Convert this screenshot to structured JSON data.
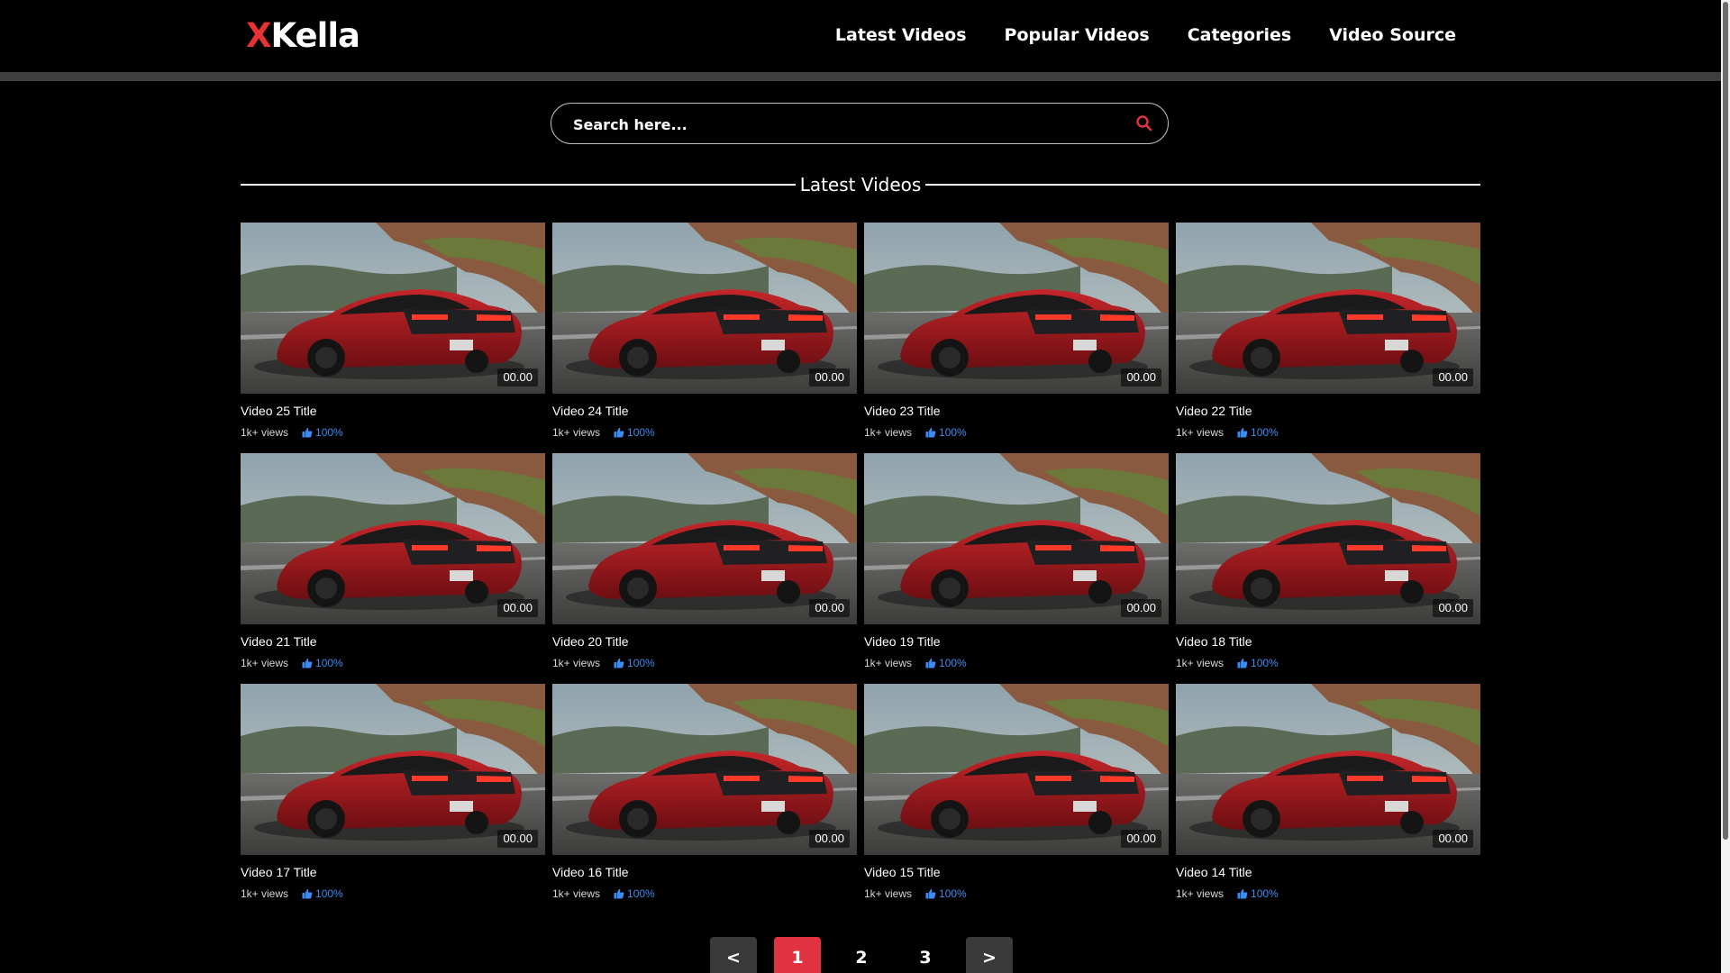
{
  "brand": {
    "logo_first": "X",
    "logo_rest": "Kella",
    "accent": "#e63333"
  },
  "nav": {
    "items": [
      "Latest Videos",
      "Popular Videos",
      "Categories",
      "Video Source"
    ]
  },
  "search": {
    "placeholder": "Search here...",
    "value": ""
  },
  "section": {
    "title": "Latest Videos"
  },
  "videos": [
    {
      "title": "Video 25 Title",
      "duration": "00.00",
      "views": "1k+ views",
      "rating": "100%"
    },
    {
      "title": "Video 24 Title",
      "duration": "00.00",
      "views": "1k+ views",
      "rating": "100%"
    },
    {
      "title": "Video 23 Title",
      "duration": "00.00",
      "views": "1k+ views",
      "rating": "100%"
    },
    {
      "title": "Video 22 Title",
      "duration": "00.00",
      "views": "1k+ views",
      "rating": "100%"
    },
    {
      "title": "Video 21 Title",
      "duration": "00.00",
      "views": "1k+ views",
      "rating": "100%"
    },
    {
      "title": "Video 20 Title",
      "duration": "00.00",
      "views": "1k+ views",
      "rating": "100%"
    },
    {
      "title": "Video 19 Title",
      "duration": "00.00",
      "views": "1k+ views",
      "rating": "100%"
    },
    {
      "title": "Video 18 Title",
      "duration": "00.00",
      "views": "1k+ views",
      "rating": "100%"
    },
    {
      "title": "Video 17 Title",
      "duration": "00.00",
      "views": "1k+ views",
      "rating": "100%"
    },
    {
      "title": "Video 16 Title",
      "duration": "00.00",
      "views": "1k+ views",
      "rating": "100%"
    },
    {
      "title": "Video 15 Title",
      "duration": "00.00",
      "views": "1k+ views",
      "rating": "100%"
    },
    {
      "title": "Video 14 Title",
      "duration": "00.00",
      "views": "1k+ views",
      "rating": "100%"
    }
  ],
  "pagination": {
    "prev": "<",
    "pages": [
      "1",
      "2",
      "3"
    ],
    "current": "1",
    "next": ">"
  },
  "colors": {
    "active_page": "#e0333f",
    "nav_button": "#3a3a3a",
    "rating": "#3b8cf0"
  }
}
